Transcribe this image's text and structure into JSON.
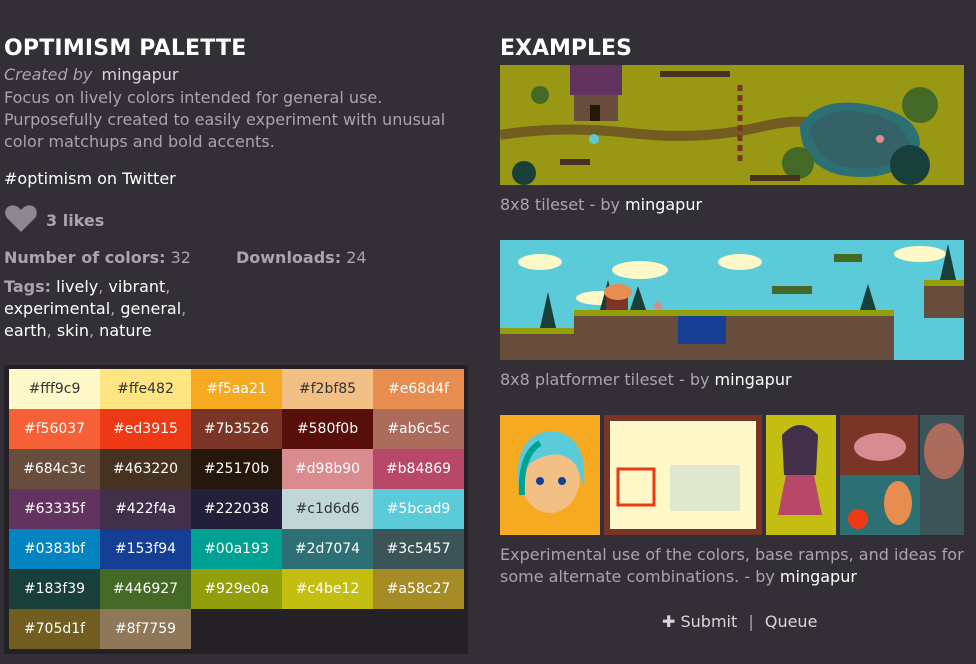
{
  "palette": {
    "title": "OPTIMISM PALETTE",
    "created_by_label": "Created by",
    "author": "mingapur",
    "description": "Focus on lively colors intended for general use. Purposefully created to easily experiment with unusual color matchups and bold accents.",
    "twitter": "#optimism on Twitter",
    "likes": "3 likes",
    "num_colors_label": "Number of colors:",
    "num_colors": "32",
    "downloads_label": "Downloads:",
    "downloads": "24",
    "tags_label": "Tags:",
    "tags": [
      "lively",
      "vibrant",
      "experimental",
      "general",
      "earth",
      "skin",
      "nature"
    ]
  },
  "swatches": [
    {
      "hex": "#fff9c9",
      "text": "#333333"
    },
    {
      "hex": "#ffe482",
      "text": "#333333"
    },
    {
      "hex": "#f5aa21",
      "text": "#ffffff"
    },
    {
      "hex": "#f2bf85",
      "text": "#333333"
    },
    {
      "hex": "#e68d4f",
      "text": "#ffffff"
    },
    {
      "hex": "#f56037",
      "text": "#ffffff"
    },
    {
      "hex": "#ed3915",
      "text": "#ffffff"
    },
    {
      "hex": "#7b3526",
      "text": "#ffffff"
    },
    {
      "hex": "#580f0b",
      "text": "#ffffff"
    },
    {
      "hex": "#ab6c5c",
      "text": "#ffffff"
    },
    {
      "hex": "#684c3c",
      "text": "#ffffff"
    },
    {
      "hex": "#463220",
      "text": "#ffffff"
    },
    {
      "hex": "#25170b",
      "text": "#ffffff"
    },
    {
      "hex": "#d98b90",
      "text": "#ffffff"
    },
    {
      "hex": "#b84869",
      "text": "#ffffff"
    },
    {
      "hex": "#63335f",
      "text": "#ffffff"
    },
    {
      "hex": "#422f4a",
      "text": "#ffffff"
    },
    {
      "hex": "#222038",
      "text": "#ffffff"
    },
    {
      "hex": "#c1d6d6",
      "text": "#333333"
    },
    {
      "hex": "#5bcad9",
      "text": "#ffffff"
    },
    {
      "hex": "#0383bf",
      "text": "#ffffff"
    },
    {
      "hex": "#153f94",
      "text": "#ffffff"
    },
    {
      "hex": "#00a193",
      "text": "#ffffff"
    },
    {
      "hex": "#2d7074",
      "text": "#ffffff"
    },
    {
      "hex": "#3c5457",
      "text": "#ffffff"
    },
    {
      "hex": "#183f39",
      "text": "#ffffff"
    },
    {
      "hex": "#446927",
      "text": "#ffffff"
    },
    {
      "hex": "#929e0a",
      "text": "#ffffff"
    },
    {
      "hex": "#c4be12",
      "text": "#ffffff"
    },
    {
      "hex": "#a58c27",
      "text": "#ffffff"
    },
    {
      "hex": "#705d1f",
      "text": "#ffffff"
    },
    {
      "hex": "#8f7759",
      "text": "#ffffff"
    }
  ],
  "examples": {
    "title": "EXAMPLES",
    "items": [
      {
        "caption_prefix": "8x8 tileset - by ",
        "author": "mingapur",
        "image": "tileset-village-image"
      },
      {
        "caption_prefix": "8x8 platformer tileset - by ",
        "author": "mingapur",
        "image": "platformer-scene-image"
      },
      {
        "caption_prefix": "Experimental use of the colors, base ramps, and ideas for some alternate combinations. - by ",
        "author": "mingapur",
        "image": "character-collage-image"
      }
    ]
  },
  "actions": {
    "submit_icon": "plus-icon",
    "submit": "Submit",
    "separator": "|",
    "queue": "Queue"
  }
}
